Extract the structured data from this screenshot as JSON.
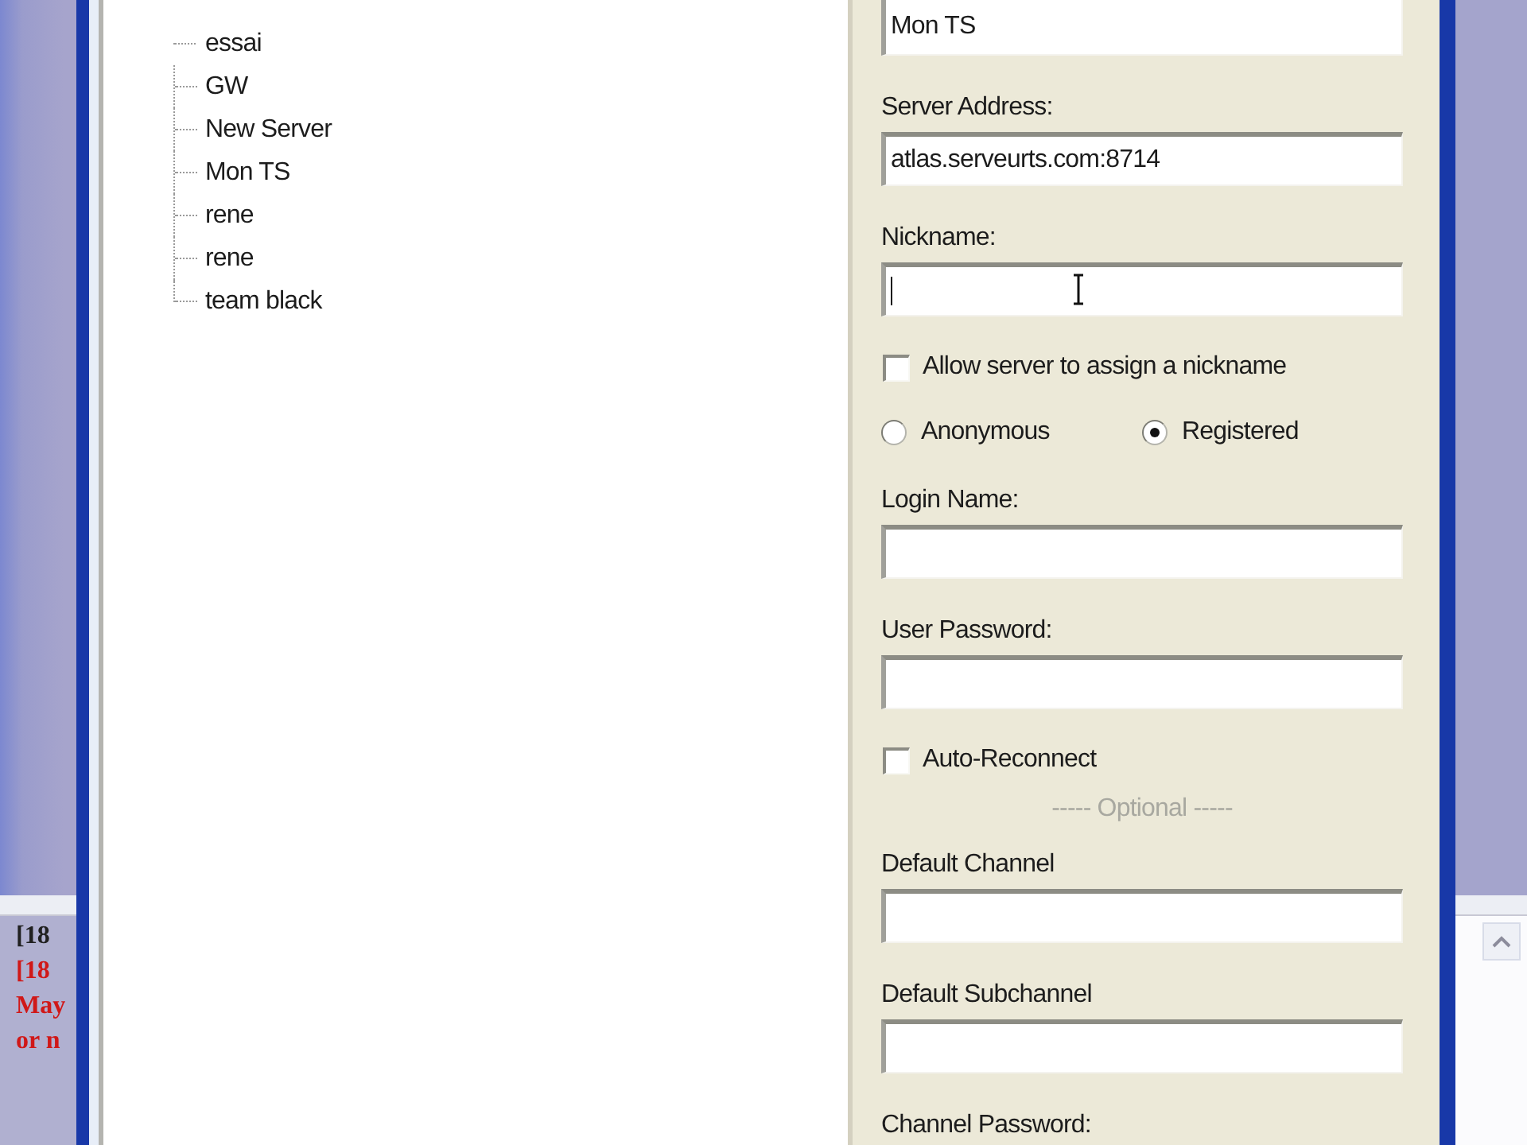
{
  "background_window": {
    "log_lines": [
      {
        "text": "[18",
        "color": "#202020"
      },
      {
        "text": "[18",
        "color": "#d01818"
      },
      {
        "text": "May",
        "color": "#d01818"
      },
      {
        "text": "or n",
        "color": "#d01818"
      }
    ]
  },
  "server_tree": {
    "items": [
      {
        "label": "essai"
      },
      {
        "label": "GW"
      },
      {
        "label": "New Server"
      },
      {
        "label": "Mon TS"
      },
      {
        "label": "rene"
      },
      {
        "label": "rene"
      },
      {
        "label": "team black"
      }
    ]
  },
  "connection_form": {
    "items": [
      {
        "kind": "field",
        "value": "Mon TS"
      },
      {
        "kind": "field",
        "label": "Server Address:",
        "value": "atlas.serveurts.com:8714"
      },
      {
        "kind": "field",
        "label": "Nickname:",
        "focused": true,
        "pointer_over": true
      },
      {
        "kind": "checkbox",
        "label": "Allow server to assign a nickname",
        "checked": false
      },
      {
        "kind": "radios",
        "options": [
          {
            "label": "Anonymous",
            "selected": false
          },
          {
            "label": "Registered",
            "selected": true
          }
        ]
      },
      {
        "kind": "field",
        "label": "Login Name:"
      },
      {
        "kind": "field",
        "label": "User Password:"
      },
      {
        "kind": "checkbox",
        "label": "Auto-Reconnect",
        "checked": false
      },
      {
        "kind": "separator",
        "label": "----- Optional -----"
      },
      {
        "kind": "field",
        "label": "Default Channel"
      },
      {
        "kind": "field",
        "label": "Default Subchannel"
      },
      {
        "kind": "label",
        "label": "Channel Password:"
      }
    ]
  }
}
